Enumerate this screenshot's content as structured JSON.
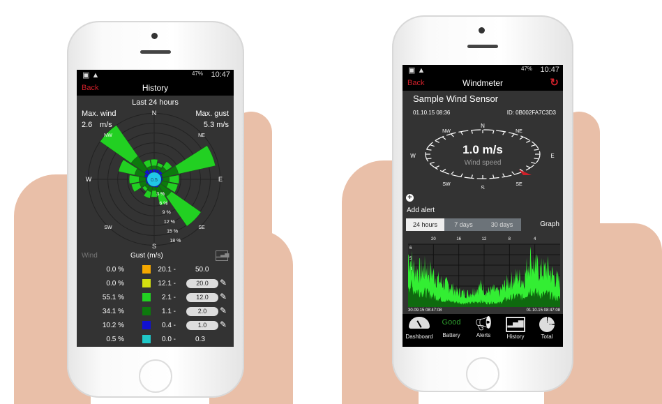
{
  "history_screen": {
    "status": {
      "battery": "47%",
      "time": "10:47"
    },
    "back_label": "Back",
    "title": "History",
    "period": "Last 24 hours",
    "max_wind_label": "Max. wind",
    "max_wind_value": "2.6",
    "max_wind_unit": "m/s",
    "max_gust_label": "Max. gust",
    "max_gust_value": "5.3",
    "max_gust_unit": "m/s",
    "center_label": "0.5",
    "ring_labels": [
      "3 %",
      "6 %",
      "9 %",
      "12 %",
      "15 %",
      "18 %"
    ],
    "directions": [
      "N",
      "NE",
      "E",
      "SE",
      "S",
      "SW",
      "W",
      "NW"
    ],
    "rose": {
      "sectors": [
        "N",
        "NNE",
        "NE",
        "ENE",
        "E",
        "ESE",
        "SE",
        "SSE",
        "S",
        "SSW",
        "SW",
        "WSW",
        "W",
        "WNW",
        "NW",
        "NNW"
      ],
      "stacks_percent": [
        [
          1,
          1,
          2
        ],
        [
          1,
          1,
          1
        ],
        [
          1,
          1.5,
          2
        ],
        [
          0.5,
          5,
          11.5
        ],
        [
          0.5,
          2,
          3
        ],
        [
          0.3,
          2,
          3
        ],
        [
          0.3,
          4,
          11
        ],
        [
          0.5,
          2,
          3.5
        ],
        [
          0.3,
          1,
          2
        ],
        [
          0.3,
          1.5,
          2
        ],
        [
          0.3,
          1,
          1
        ],
        [
          0.5,
          2,
          2.5
        ],
        [
          0.5,
          2,
          3
        ],
        [
          1,
          3,
          5
        ],
        [
          1.5,
          5,
          11.5
        ],
        [
          1,
          1,
          2
        ]
      ],
      "colors": [
        "#1010d0",
        "#0d7a0d",
        "#22d022"
      ]
    },
    "legend_header": {
      "wind": "Wind",
      "gust": "Gust (m/s)"
    },
    "legend": [
      {
        "pct": "0.0 %",
        "color": "#f5a800",
        "from": "20.1 -",
        "to": "50.0",
        "editable": false
      },
      {
        "pct": "0.0 %",
        "color": "#d4e010",
        "from": "12.1 -",
        "to": "20.0",
        "editable": true
      },
      {
        "pct": "55.1 %",
        "color": "#22d022",
        "from": "2.1 -",
        "to": "12.0",
        "editable": true
      },
      {
        "pct": "34.1 %",
        "color": "#0d7a0d",
        "from": "1.1 -",
        "to": "2.0",
        "editable": true
      },
      {
        "pct": "10.2 %",
        "color": "#1010d0",
        "from": "0.4 -",
        "to": "1.0",
        "editable": true
      },
      {
        "pct": "0.5 %",
        "color": "#20c8c8",
        "from": "0.0 -",
        "to": "0.3",
        "editable": false
      }
    ]
  },
  "windmeter_screen": {
    "status": {
      "battery": "47%",
      "time": "10:47"
    },
    "back_label": "Back",
    "title": "Windmeter",
    "sensor_name": "Sample Wind Sensor",
    "timestamp": "01.10.15  08:36",
    "sensor_id": "ID: 0B002FA7C3D3",
    "compass": [
      "N",
      "NE",
      "E",
      "SE",
      "S",
      "SW",
      "W",
      "NW"
    ],
    "speed": "1.0 m/s",
    "speed_label": "Wind speed",
    "direction": "SE",
    "add_alert": "Add alert",
    "tabs": [
      {
        "label": "24 hours",
        "active": true
      },
      {
        "label": "7 days",
        "active": false
      },
      {
        "label": "30 days",
        "active": false
      }
    ],
    "graph_label": "Graph",
    "chart_data": {
      "type": "area",
      "x_ticks": [
        "20",
        "16",
        "12",
        "8",
        "4"
      ],
      "y_ticks": [
        "1",
        "2",
        "3",
        "4",
        "5",
        "6"
      ],
      "ylim": [
        0,
        6
      ],
      "x_start": "30.09.15  08:47:08",
      "x_end": "01.10.15  08:47:08",
      "series": [
        {
          "values": [
            5.5,
            4,
            3.8,
            4,
            3.6,
            2.8,
            2.4,
            2.2,
            1.6,
            1.5,
            1.4,
            1.8,
            2.2,
            1.6,
            1.8,
            1.5,
            2.4,
            2.8,
            3.2,
            2.8,
            5.2,
            4.2,
            3.8,
            4,
            3.2,
            2.6
          ]
        },
        {
          "values": [
            2.5,
            1.8,
            1.6,
            1.5,
            1.2,
            0.9,
            0.7,
            0.6,
            0.5,
            0.4,
            0.4,
            0.5,
            0.6,
            0.4,
            0.5,
            0.4,
            0.8,
            1,
            1.2,
            1,
            1.8,
            1.5,
            1.3,
            1.4,
            1,
            0.9
          ]
        }
      ],
      "colors": [
        "#33ee33",
        "#0f6a0f"
      ],
      "grid": true
    },
    "nav": [
      {
        "label": "Dashboard",
        "icon": "gauge-icon"
      },
      {
        "label": "Battery",
        "value": "Good",
        "icon": ""
      },
      {
        "label": "Alerts",
        "icon": "megaphone-icon"
      },
      {
        "label": "History",
        "icon": "bar-chart-icon"
      },
      {
        "label": "Total",
        "icon": "pie-chart-icon"
      }
    ],
    "battery_color": "#2e9e2e"
  }
}
